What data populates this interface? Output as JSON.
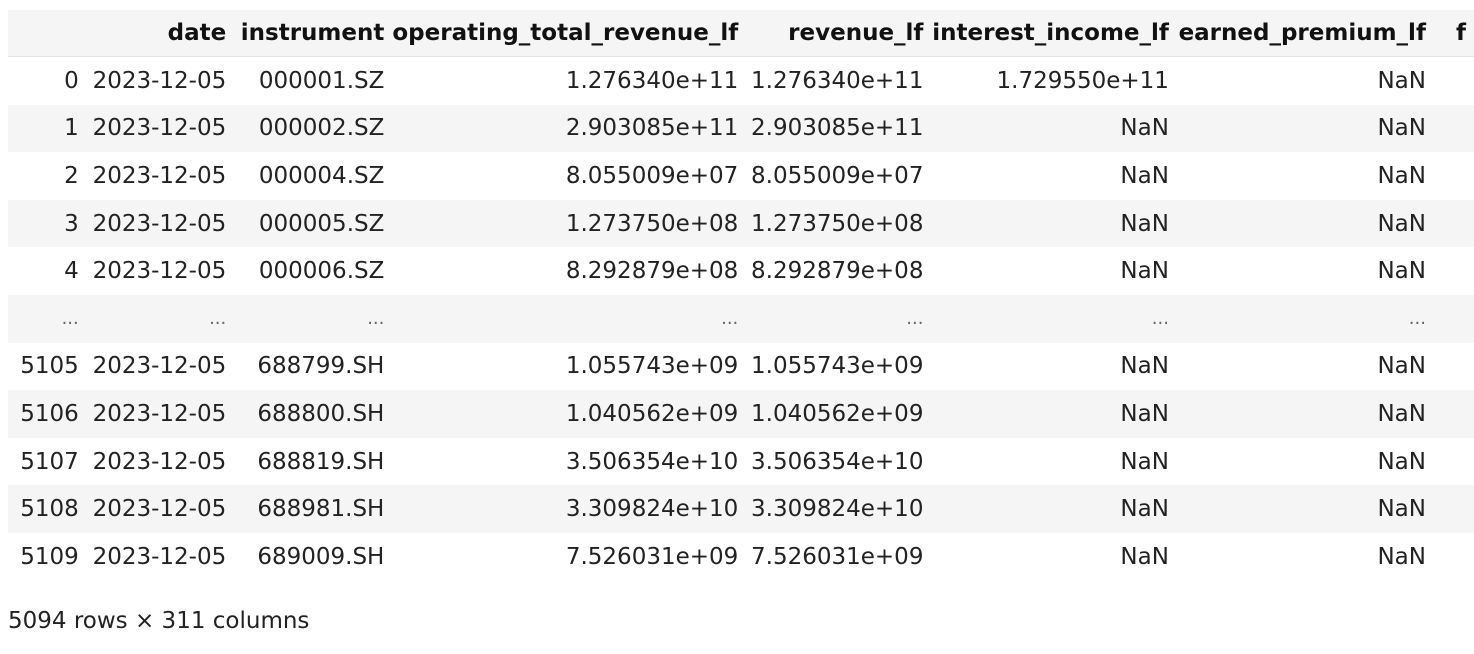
{
  "table": {
    "columns": [
      "",
      "date",
      "instrument",
      "operating_total_revenue_lf",
      "revenue_lf",
      "interest_income_lf",
      "earned_premium_lf",
      "f"
    ],
    "rows": [
      [
        "0",
        "2023-12-05",
        "000001.SZ",
        "1.276340e+11",
        "1.276340e+11",
        "1.729550e+11",
        "NaN"
      ],
      [
        "1",
        "2023-12-05",
        "000002.SZ",
        "2.903085e+11",
        "2.903085e+11",
        "NaN",
        "NaN"
      ],
      [
        "2",
        "2023-12-05",
        "000004.SZ",
        "8.055009e+07",
        "8.055009e+07",
        "NaN",
        "NaN"
      ],
      [
        "3",
        "2023-12-05",
        "000005.SZ",
        "1.273750e+08",
        "1.273750e+08",
        "NaN",
        "NaN"
      ],
      [
        "4",
        "2023-12-05",
        "000006.SZ",
        "8.292879e+08",
        "8.292879e+08",
        "NaN",
        "NaN"
      ],
      [
        "...",
        "...",
        "...",
        "...",
        "...",
        "...",
        "..."
      ],
      [
        "5105",
        "2023-12-05",
        "688799.SH",
        "1.055743e+09",
        "1.055743e+09",
        "NaN",
        "NaN"
      ],
      [
        "5106",
        "2023-12-05",
        "688800.SH",
        "1.040562e+09",
        "1.040562e+09",
        "NaN",
        "NaN"
      ],
      [
        "5107",
        "2023-12-05",
        "688819.SH",
        "3.506354e+10",
        "3.506354e+10",
        "NaN",
        "NaN"
      ],
      [
        "5108",
        "2023-12-05",
        "688981.SH",
        "3.309824e+10",
        "3.309824e+10",
        "NaN",
        "NaN"
      ],
      [
        "5109",
        "2023-12-05",
        "689009.SH",
        "7.526031e+09",
        "7.526031e+09",
        "NaN",
        "NaN"
      ]
    ]
  },
  "footer": {
    "shape_text": "5094 rows × 311 columns"
  }
}
